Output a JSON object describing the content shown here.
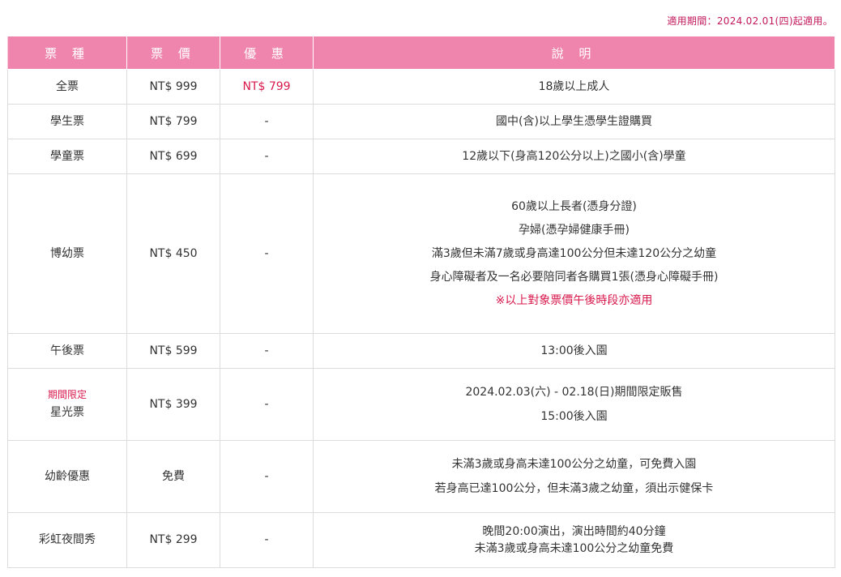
{
  "period_note": "適用期間：2024.02.01(四)起適用。",
  "headers": {
    "type": "票 種",
    "price": "票 價",
    "discount": "優 惠",
    "desc": "說 明"
  },
  "rows": [
    {
      "type": "全票",
      "price": "NT$ 999",
      "discount": "NT$ 799",
      "desc": [
        "18歲以上成人"
      ]
    },
    {
      "type": "學生票",
      "price": "NT$ 799",
      "discount": "-",
      "desc": [
        "國中(含)以上學生憑學生證購買"
      ]
    },
    {
      "type": "學童票",
      "price": "NT$ 699",
      "discount": "-",
      "desc": [
        "12歲以下(身高120公分以上)之國小(含)學童"
      ]
    },
    {
      "type": "博幼票",
      "price": "NT$ 450",
      "discount": "-",
      "desc": [
        "60歲以上長者(憑身分證)",
        "孕婦(憑孕婦健康手冊)",
        "滿3歲但未滿7歲或身高達100公分但未達120公分之幼童",
        "身心障礙者及一名必要陪同者各購買1張(憑身心障礙手冊)"
      ],
      "note": "※以上對象票價午後時段亦適用"
    },
    {
      "type": "午後票",
      "price": "NT$ 599",
      "discount": "-",
      "desc": [
        "13:00後入園"
      ]
    },
    {
      "limited": "期間限定",
      "type": "星光票",
      "price": "NT$ 399",
      "discount": "-",
      "desc": [
        "2024.02.03(六) - 02.18(日)期間限定販售",
        "15:00後入園"
      ]
    },
    {
      "type": "幼齡優惠",
      "price": "免費",
      "discount": "-",
      "desc": [
        "未滿3歲或身高未達100公分之幼童，可免費入園",
        "若身高已達100公分，但未滿3歲之幼童，須出示健保卡"
      ]
    },
    {
      "type": "彩虹夜間秀",
      "price": "NT$ 299",
      "discount": "-",
      "desc": [
        "晚間20:00演出，演出時間約40分鐘",
        "未滿3歲或身高未達100公分之幼童免費"
      ]
    }
  ],
  "colors": {
    "header_bg": "#ef85ad",
    "accent": "#d8194c"
  }
}
